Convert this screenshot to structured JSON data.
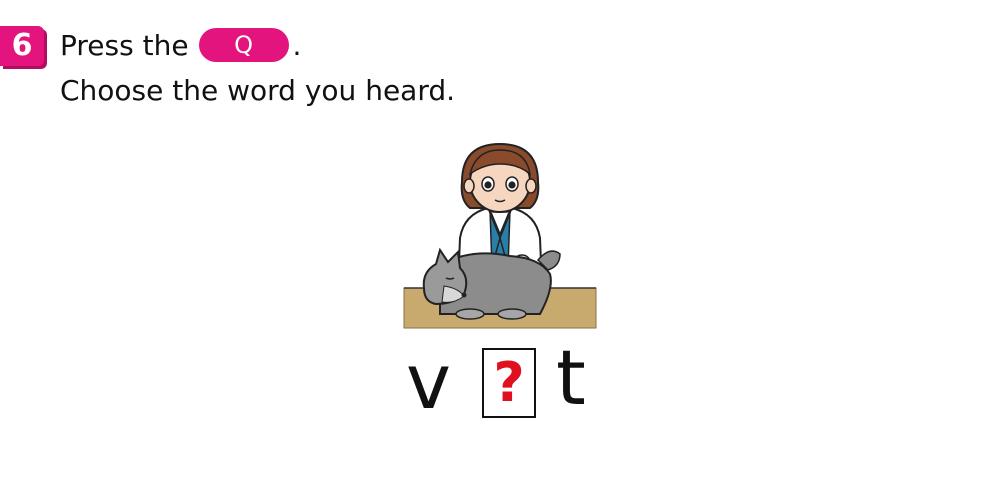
{
  "question": {
    "number": "6",
    "instruction_prefix": "Press the",
    "key_label": "Q",
    "instruction_suffix": ".",
    "prompt": "Choose the word you heard."
  },
  "word": {
    "first_letter": "v",
    "missing_placeholder": "?",
    "last_letter": "t"
  },
  "illustration": {
    "icon": "vet-with-dog-illustration"
  },
  "colors": {
    "accent": "#e3147e",
    "question_mark": "#e0101e",
    "table": "#c8aa6e",
    "coat": "#ffffff",
    "shirt": "#2a7fa8",
    "dog": "#8c8c8c"
  }
}
